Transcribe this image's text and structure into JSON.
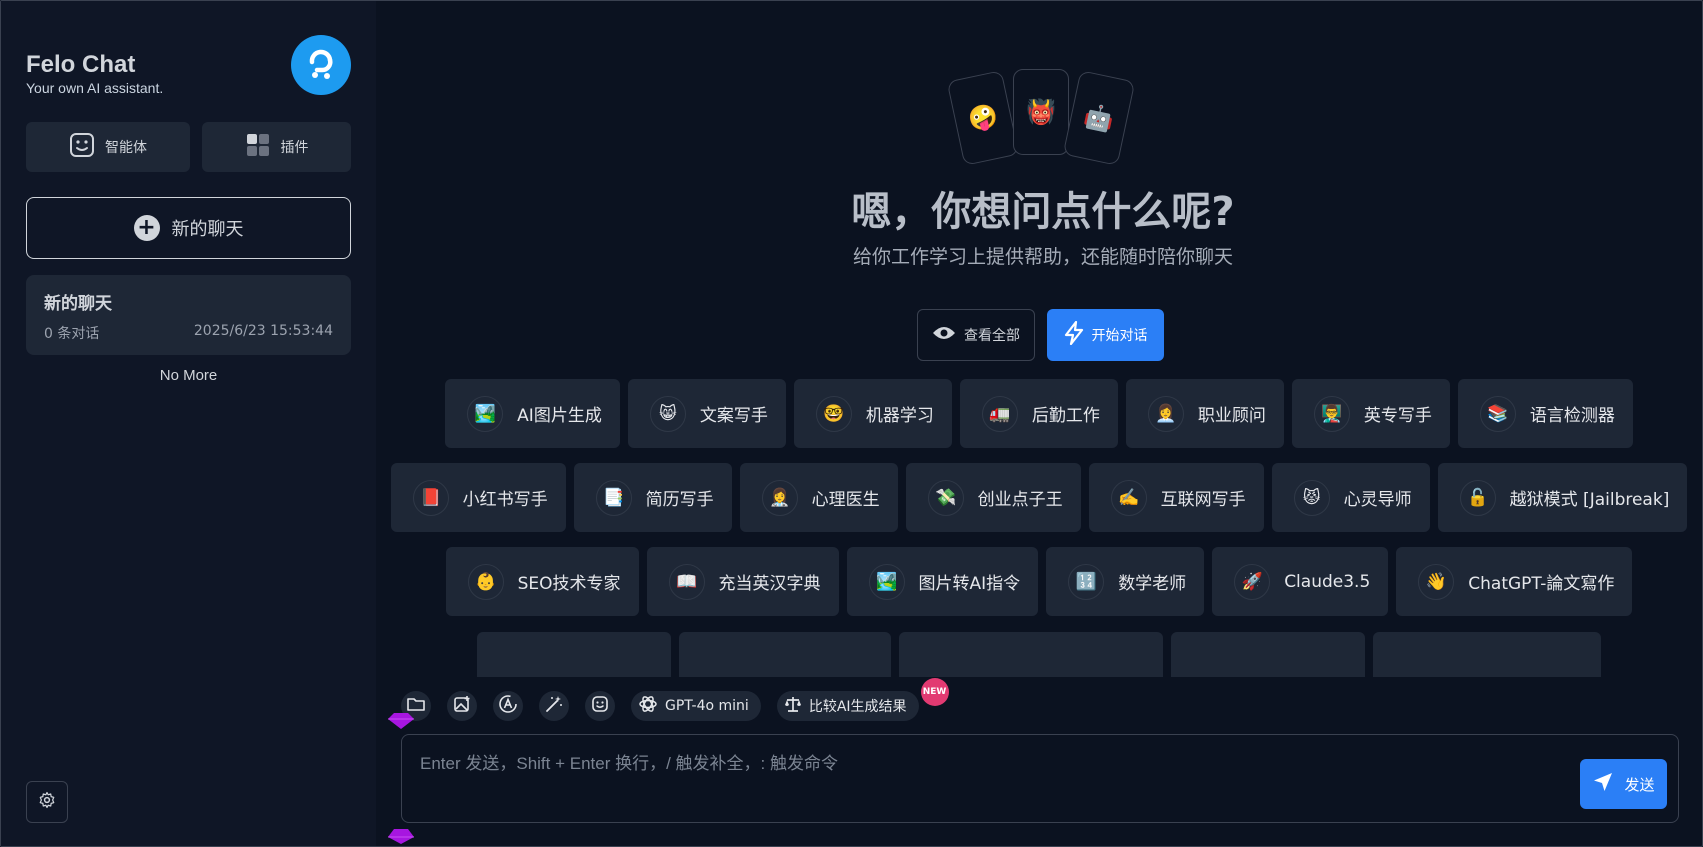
{
  "sidebar": {
    "brand_title": "Felo Chat",
    "brand_subtitle": "Your own AI assistant.",
    "agents_label": "智能体",
    "plugins_label": "插件",
    "new_chat_label": "新的聊天",
    "chats": [
      {
        "title": "新的聊天",
        "count": "0 条对话",
        "time": "2025/6/23 15:53:44"
      }
    ],
    "no_more": "No More"
  },
  "hero": {
    "cards": [
      "🤪",
      "👹",
      "🤖"
    ],
    "title": "嗯，你想问点什么呢?",
    "subtitle": "给你工作学习上提供帮助，还能随时陪你聊天",
    "view_all": "查看全部",
    "start_chat": "开始对话"
  },
  "masks": {
    "row1": [
      {
        "emoji": "🏞️",
        "label": "AI图片生成"
      },
      {
        "emoji": "😸",
        "label": "文案写手"
      },
      {
        "emoji": "🤓",
        "label": "机器学习"
      },
      {
        "emoji": "🚛",
        "label": "后勤工作"
      },
      {
        "emoji": "👩‍💼",
        "label": "职业顾问"
      },
      {
        "emoji": "👨‍🏫",
        "label": "英专写手"
      },
      {
        "emoji": "📚",
        "label": "语言检测器"
      }
    ],
    "row2": [
      {
        "emoji": "📕",
        "label": "小红书写手"
      },
      {
        "emoji": "📑",
        "label": "简历写手"
      },
      {
        "emoji": "👩‍⚕️",
        "label": "心理医生"
      },
      {
        "emoji": "💸",
        "label": "创业点子王"
      },
      {
        "emoji": "✍️",
        "label": "互联网写手"
      },
      {
        "emoji": "😾",
        "label": "心灵导师"
      },
      {
        "emoji": "🔓",
        "label": "越狱模式 [Jailbreak]"
      }
    ],
    "row3": [
      {
        "emoji": "👶",
        "label": "SEO技术专家"
      },
      {
        "emoji": "📖",
        "label": "充当英汉字典"
      },
      {
        "emoji": "🏞️",
        "label": "图片转AI指令"
      },
      {
        "emoji": "🔢",
        "label": "数学老师"
      },
      {
        "emoji": "🚀",
        "label": "Claude3.5"
      },
      {
        "emoji": "👋",
        "label": "ChatGPT-論文寫作"
      }
    ]
  },
  "toolbar": {
    "model_label": "GPT-4o mini",
    "compare_label": "比较AI生成结果",
    "new_badge": "NEW"
  },
  "input": {
    "placeholder": "Enter 发送，Shift + Enter 换行，/ 触发补全，: 触发命令",
    "send_label": "发送"
  }
}
